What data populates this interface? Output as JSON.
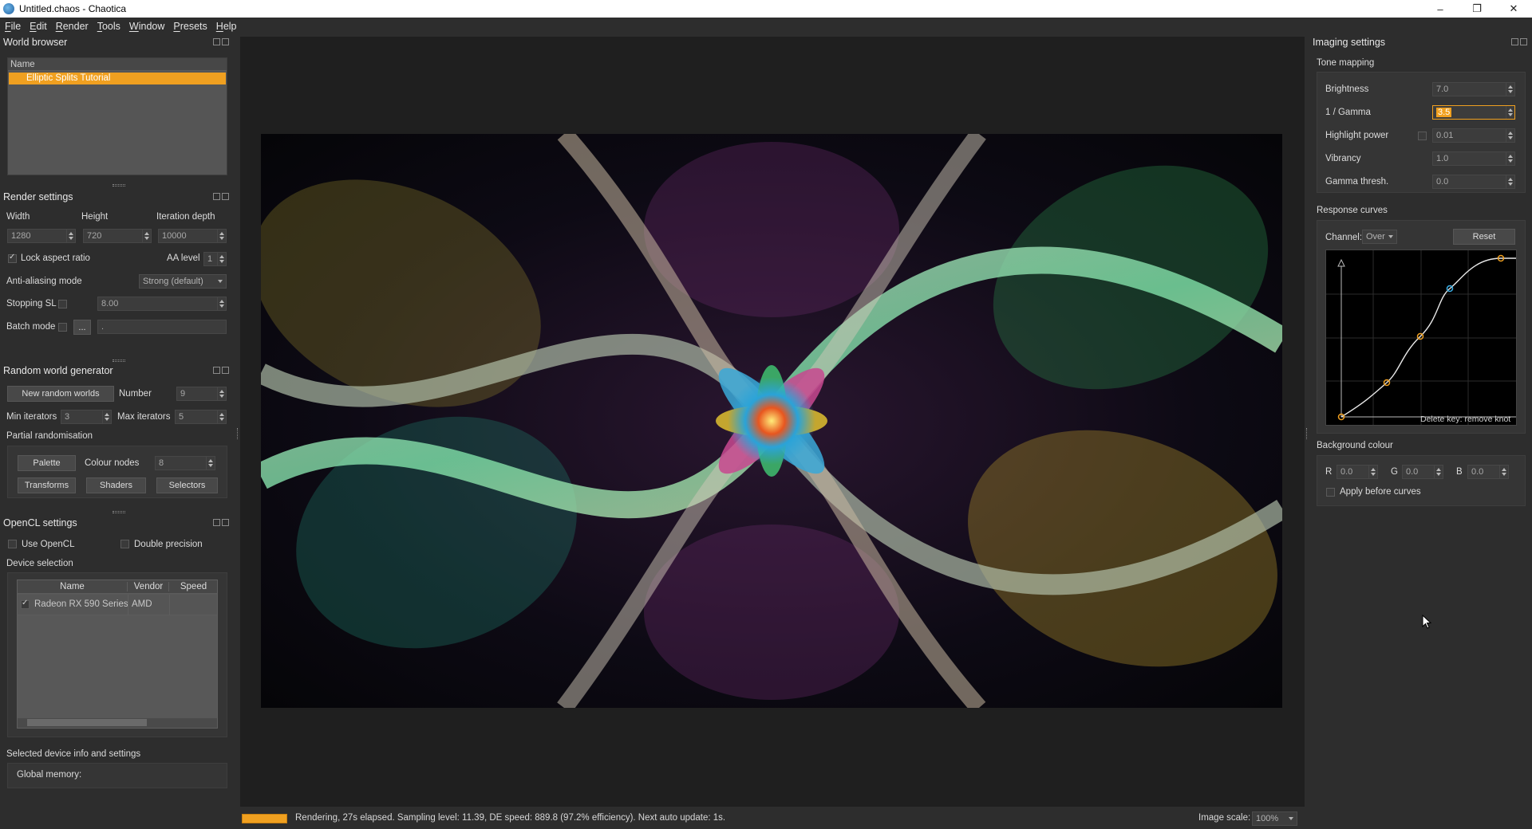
{
  "window": {
    "title": "Untitled.chaos - Chaotica",
    "minimize": "–",
    "maximize": "❐",
    "close": "✕"
  },
  "menu": [
    "File",
    "Edit",
    "Render",
    "Tools",
    "Window",
    "Presets",
    "Help"
  ],
  "world_browser": {
    "title": "World browser",
    "column_name": "Name",
    "items": [
      "Elliptic Splits Tutorial"
    ]
  },
  "render_settings": {
    "title": "Render settings",
    "width_label": "Width",
    "height_label": "Height",
    "iteration_label": "Iteration depth",
    "width": "1280",
    "height": "720",
    "iteration_depth": "10000",
    "lock_aspect_label": "Lock aspect ratio",
    "lock_aspect_checked": true,
    "aa_level_label": "AA level",
    "aa_level": "1",
    "aa_mode_label": "Anti-aliasing mode",
    "aa_mode": "Strong (default)",
    "stopping_sl_label": "Stopping SL",
    "stopping_sl": "8.00",
    "batch_mode_label": "Batch mode",
    "batch_button": "...",
    "batch_path": "."
  },
  "random_world": {
    "title": "Random world generator",
    "new_button": "New random worlds",
    "number_label": "Number",
    "number": "9",
    "min_iter_label": "Min iterators",
    "min_iter": "3",
    "max_iter_label": "Max iterators",
    "max_iter": "5",
    "partial_label": "Partial randomisation",
    "palette_button": "Palette",
    "colour_nodes_label": "Colour nodes",
    "colour_nodes": "8",
    "transforms_button": "Transforms",
    "shaders_button": "Shaders",
    "selectors_button": "Selectors"
  },
  "opencl": {
    "title": "OpenCL settings",
    "use_opencl_label": "Use OpenCL",
    "double_precision_label": "Double precision",
    "device_selection_label": "Device selection",
    "columns": [
      "Name",
      "Vendor",
      "Speed"
    ],
    "device_name": "Radeon RX 590 Series",
    "device_vendor": "AMD",
    "device_speed": "",
    "selected_info_label": "Selected device info and settings",
    "global_memory_label": "Global memory:"
  },
  "status": {
    "progress": 1.0,
    "text": "Rendering, 27s elapsed. Sampling level: 11.39, DE speed: 889.8 (97.2% efficiency). Next auto update: 1s.",
    "image_scale_label": "Image scale:",
    "image_scale": "100%"
  },
  "imaging": {
    "title": "Imaging settings",
    "tone_mapping_label": "Tone mapping",
    "brightness_label": "Brightness",
    "brightness": "7.0",
    "gamma_label": "1 / Gamma",
    "gamma": "3.5",
    "highlight_label": "Highlight power",
    "highlight": "0.01",
    "vibrancy_label": "Vibrancy",
    "vibrancy": "1.0",
    "gamma_thresh_label": "Gamma thresh.",
    "gamma_thresh": "0.0",
    "response_curves_label": "Response curves",
    "channel_label": "Channel:",
    "channel": "Over",
    "reset_button": "Reset",
    "delete_key_hint": "Delete key: remove knot",
    "background_colour_label": "Background colour",
    "r_label": "R",
    "r": "0.0",
    "g_label": "G",
    "g": "0.0",
    "b_label": "B",
    "b": "0.0",
    "apply_before_curves_label": "Apply before curves"
  },
  "colors": {
    "accent": "#f0a020",
    "selection": "#f0a020",
    "panel_bg": "#2d2d2d",
    "viewport_bg": "#1f1f1f"
  }
}
